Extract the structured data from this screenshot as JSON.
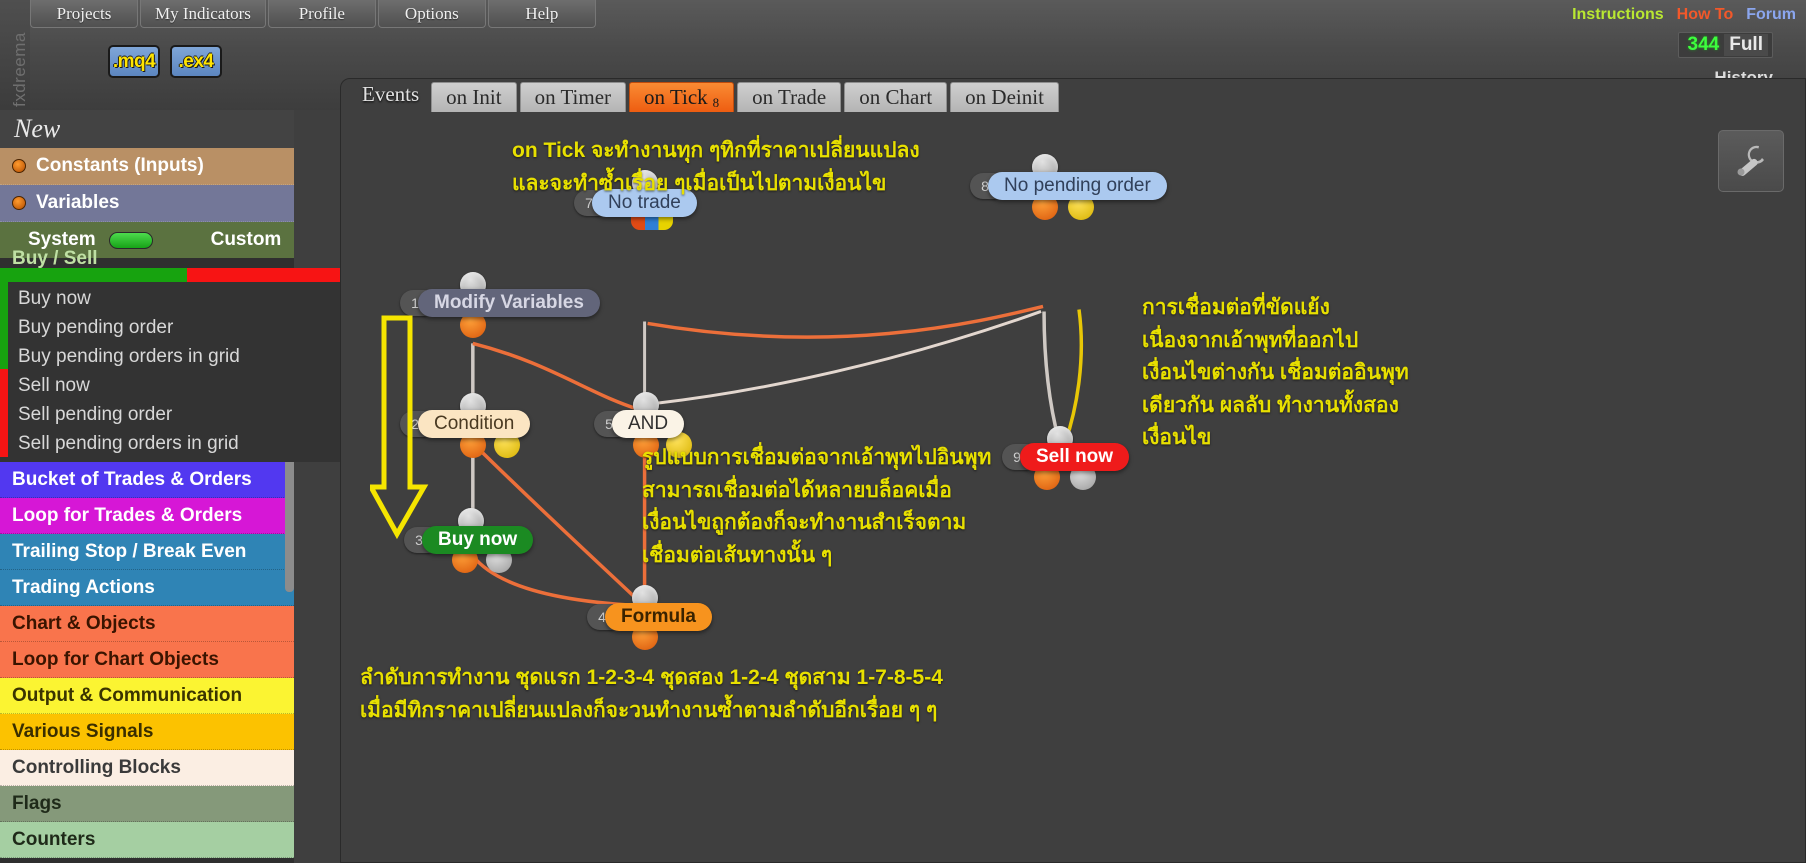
{
  "brand": "fxdreema",
  "menu": {
    "items": [
      {
        "label": "Projects"
      },
      {
        "label": "My Indicators"
      },
      {
        "label": "Profile"
      },
      {
        "label": "Options"
      },
      {
        "label": "Help"
      }
    ]
  },
  "format_buttons": [
    {
      "label": ".mq4"
    },
    {
      "label": ".ex4"
    }
  ],
  "top_links": [
    {
      "label": "Instructions",
      "color": "#b9e832"
    },
    {
      "label": "How To",
      "color": "#f2582a"
    },
    {
      "label": "Forum",
      "color": "#8ba6ee"
    }
  ],
  "counter": {
    "value": "344",
    "mode": "Full",
    "history_label": "History"
  },
  "events": {
    "label": "Events",
    "tabs": [
      {
        "label": "on Init",
        "badge": "",
        "active": false
      },
      {
        "label": "on Timer",
        "badge": "",
        "active": false
      },
      {
        "label": "on Tick",
        "badge": "8",
        "active": true
      },
      {
        "label": "on Trade",
        "badge": "",
        "active": false
      },
      {
        "label": "on Chart",
        "badge": "",
        "active": false
      },
      {
        "label": "on Deinit",
        "badge": "",
        "active": false
      }
    ]
  },
  "sidebar": {
    "new_label": "New",
    "constants_label": "Constants (Inputs)",
    "variables_label": "Variables",
    "toggles": [
      {
        "label": "System",
        "state": "on"
      },
      {
        "label": "Custom",
        "state": "off"
      }
    ],
    "buy_sell_label": "Buy / Sell",
    "orders": [
      {
        "label": "Buy now"
      },
      {
        "label": "Buy pending order"
      },
      {
        "label": "Buy pending orders in grid"
      },
      {
        "label": "Sell now"
      },
      {
        "label": "Sell pending order"
      },
      {
        "label": "Sell pending orders in grid"
      }
    ],
    "categories": [
      {
        "label": "Bucket of Trades & Orders",
        "bg": "#5238f0",
        "fg": "#ffffff"
      },
      {
        "label": "Loop for Trades & Orders",
        "bg": "#d617d6",
        "fg": "#ffffff"
      },
      {
        "label": "Trailing Stop / Break Even",
        "bg": "#2f84b5",
        "fg": "#ffffff"
      },
      {
        "label": "Trading Actions",
        "bg": "#2f84b5",
        "fg": "#ffffff"
      },
      {
        "label": "Chart & Objects",
        "bg": "#f9744c",
        "fg": "#3a1400"
      },
      {
        "label": "Loop for Chart Objects",
        "bg": "#f9744c",
        "fg": "#3a1400"
      },
      {
        "label": "Output & Communication",
        "bg": "#fbf432",
        "fg": "#3a3400"
      },
      {
        "label": "Various Signals",
        "bg": "#fcc200",
        "fg": "#3a2e00"
      },
      {
        "label": "Controlling Blocks",
        "bg": "#fbeee3",
        "fg": "#3a3a3a"
      },
      {
        "label": "Flags",
        "bg": "#85997a",
        "fg": "#1f2a19"
      },
      {
        "label": "Counters",
        "bg": "#a5cfa2",
        "fg": "#1f2a19"
      }
    ]
  },
  "flow": {
    "nodes": [
      {
        "index": "1",
        "label": "Modify Variables",
        "style": "nb-grey"
      },
      {
        "index": "2",
        "label": "Condition",
        "style": "nb-cream"
      },
      {
        "index": "3",
        "label": "Buy now",
        "style": "nb-green"
      },
      {
        "index": "4",
        "label": "Formula",
        "style": "nb-orange"
      },
      {
        "index": "5",
        "label": "AND",
        "style": "nb-white"
      },
      {
        "index": "7",
        "label": "No trade",
        "style": "nb-blue"
      },
      {
        "index": "8",
        "label": "No pending order",
        "style": "nb-blue"
      },
      {
        "index": "9",
        "label": "Sell now",
        "style": "nb-red"
      }
    ]
  },
  "notes": {
    "top": "on Tick จะทำงานทุก ๆทิกที่ราคาเปลี่ยนแปลง\nและจะทำซ้ำเรื่อย ๆเมื่อเป็นไปตามเงื่อนไข",
    "right": "การเชื่อมต่อที่ขัดแย้ง\nเนื่องจากเอ้าพุทที่ออกไป\nเงื่อนไขต่างกัน เชื่อมต่ออินพุท\nเดียวกัน ผลลับ ทำงานทั้งสอง\nเงื่อนไข",
    "middle": "รูปแบบการเชื่อมต่อจากเอ้าพุทไปอินพุท\nสามารถเชื่อมต่อได้หลายบล็อคเมื่อ\nเงื่อนไขถูกต้องก็จะทำงานสำเร็จตาม\nเชื่อมต่อเส้นทางนั้น ๆ",
    "bottom": "ลำดับการทำงาน ชุดแรก 1-2-3-4  ชุดสอง 1-2-4 ชุดสาม 1-7-8-5-4\nเมื่อมีทิกราคาเปลี่ยนแปลงก็จะวนทำงานซ้ำตามลำดับอีกเรื่อย ๆ ๆ"
  },
  "tool_button": {
    "icon": "wrench-icon"
  }
}
